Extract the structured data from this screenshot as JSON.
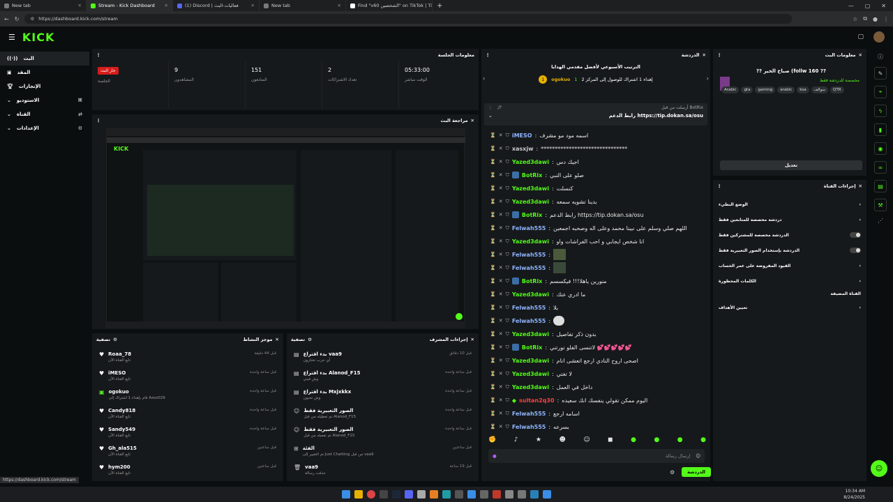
{
  "browser": {
    "tabs": [
      {
        "label": "New tab",
        "color": "#7a7a7a"
      },
      {
        "label": "Stream - Kick Dashboard",
        "color": "#53fc18"
      },
      {
        "label": "(1) Discord | فعاليات-البث",
        "color": "#5865f2"
      },
      {
        "label": "New tab",
        "color": "#7a7a7a"
      },
      {
        "label": "Find \"v60 الشخصين\" on TikTok | Ti",
        "color": "#ffffff"
      }
    ],
    "url": "https://dashboard.kick.com/stream",
    "status_url": "https://dashboard.kick.com/stream"
  },
  "brand": {
    "logo": "KICK",
    "accent": "#53fc18"
  },
  "sidebar": {
    "items": [
      {
        "label": "البث",
        "icon": "broadcast-icon"
      },
      {
        "label": "المقد",
        "icon": "content-icon"
      },
      {
        "label": "الإنجازات",
        "icon": "trophy-icon"
      },
      {
        "label": "الاستوديو",
        "icon": "studio-icon"
      },
      {
        "label": "القناة",
        "icon": "channel-icon"
      },
      {
        "label": "الإعدادات",
        "icon": "settings-icon"
      }
    ]
  },
  "session": {
    "title": "معلومات الجلسة",
    "stats": [
      {
        "value": "جار البث",
        "label": "الجلسة"
      },
      {
        "value": "9",
        "label": "المشاهدون"
      },
      {
        "value": "151",
        "label": "المتابعون"
      },
      {
        "value": "2",
        "label": "تعداد الاشتراكات"
      },
      {
        "value": "05:33:00",
        "label": "الوقت مباشر"
      }
    ]
  },
  "preview": {
    "title": "مراجعة البث"
  },
  "activity": {
    "title": "موجز النشاط",
    "filter": "تصفية",
    "items": [
      {
        "name": "Roaa_78",
        "sub": "تابع القناة الآن",
        "time": "قبل 44 دقيقة"
      },
      {
        "name": "iMESO",
        "sub": "تابع القناة الآن",
        "time": "قبل ساعة واحدة"
      },
      {
        "name": "ogokuo",
        "sub": "قام بإهداء 1 اشتراك إلى Azoz029",
        "time": "قبل ساعة واحدة"
      },
      {
        "name": "Candy818",
        "sub": "تابع القناة الآن",
        "time": "قبل ساعة واحدة"
      },
      {
        "name": "Sandy549",
        "sub": "تابع القناة الآن",
        "time": "قبل ساعة واحدة"
      },
      {
        "name": "Gh_ala515",
        "sub": "تابع القناة الآن",
        "time": "قبل ساعتين"
      },
      {
        "name": "hym200",
        "sub": "تابع القناة الآن",
        "time": "قبل ساعتين"
      }
    ]
  },
  "modactions": {
    "title": "إجراءات المشرف",
    "filter": "تصفية",
    "items": [
      {
        "title": "بدء اقتراع vaa9",
        "sub": "أي حزب تختارون",
        "time": "قبل 10 دقائق"
      },
      {
        "title": "بدء اقتراع Alanod_F15",
        "sub": "وش فيني",
        "time": "قبل ساعة واحدة"
      },
      {
        "title": "بدء اقتراع Mxjxkkx",
        "sub": "وش تحبون",
        "time": "قبل ساعة واحدة"
      },
      {
        "title": "الصور التعبيرية فقط",
        "sub": "تم تعطيله من قبل Alanod_F15",
        "time": "قبل ساعة واحدة"
      },
      {
        "title": "الصور التعبيرية فقط",
        "sub": "تم تفعيله من قبل Alanod_F15",
        "time": "قبل ساعة واحدة"
      },
      {
        "title": "الفئة",
        "sub": "تم التغيير إلى Just Chatting من قبل vaa9",
        "time": "قبل ساعتين"
      },
      {
        "title": "vaa9",
        "sub": "حذفت رسالة",
        "time": "قبل 19 ساعة"
      }
    ]
  },
  "chat": {
    "title": "الدردشة",
    "leaderboard_title": "الترتيب الأسبوعي لأفضل مقدمي الهدايا",
    "leader": {
      "rank": "1",
      "name": "ogokuo",
      "count": "1"
    },
    "leader_note": "إهداء 1 اشتراك للوصول إلى المركز 2",
    "pinned_by": "أرسلت من قبل BotRix",
    "pinned_text": "رابط الدعم https://tip.dokan.sa/osu",
    "messages": [
      {
        "user": "iMESO",
        "color": "#8fb4ff",
        "text": "اسمه مود مو مشرف"
      },
      {
        "user": "xasxjw",
        "color": "#c9c9c9",
        "text": "*******************************"
      },
      {
        "user": "Yazed3dawi",
        "color": "#53fc18",
        "text": "اجيك دس"
      },
      {
        "user": "BotRix",
        "color": "#53fc18",
        "text": "صلو على النبي"
      },
      {
        "user": "Yazed3dawi",
        "color": "#53fc18",
        "text": "كنسلت"
      },
      {
        "user": "Yazed3dawi",
        "color": "#53fc18",
        "text": "بدينا تشويه سمعه"
      },
      {
        "user": "BotRix",
        "color": "#53fc18",
        "text": "رابط الدعم https://tip.dokan.sa/osu"
      },
      {
        "user": "Felwah555",
        "color": "#8fb4ff",
        "text": "اللهم صلي وسلم على نبينا محمد وعلى اله وصحبه اجمعين"
      },
      {
        "user": "Yazed3dawi",
        "color": "#53fc18",
        "text": "انا شخص ايجابي و احب الفراشات واو"
      },
      {
        "user": "Felwah555",
        "color": "#8fb4ff",
        "text": ""
      },
      {
        "user": "Felwah555",
        "color": "#8fb4ff",
        "text": ""
      },
      {
        "user": "BotRix",
        "color": "#53fc18",
        "text": "منورين ياهلا!!! فيكسسم"
      },
      {
        "user": "Yazed3dawi",
        "color": "#53fc18",
        "text": "ما ادري عنك"
      },
      {
        "user": "Felwah555",
        "color": "#8fb4ff",
        "text": "بلا"
      },
      {
        "user": "Felwah555",
        "color": "#8fb4ff",
        "text": ""
      },
      {
        "user": "Yazed3dawi",
        "color": "#53fc18",
        "text": "بدون ذكر تفاصيل"
      },
      {
        "user": "BotRix",
        "color": "#53fc18",
        "text": "لاتنسى الفلو نورتني 💕💕💕💕💕"
      },
      {
        "user": "Yazed3dawi",
        "color": "#53fc18",
        "text": "اصحى اروح النادي ارجع اتعشى انام"
      },
      {
        "user": "Yazed3dawi",
        "color": "#53fc18",
        "text": "لا تغتي"
      },
      {
        "user": "Yazed3dawi",
        "color": "#53fc18",
        "text": "داخل في العمل"
      },
      {
        "user": "sultan2q30",
        "color": "#ff4040",
        "text": "اليوم ممكن تقولي ينفسك انك سعيده"
      },
      {
        "user": "Felwah555",
        "color": "#8fb4ff",
        "text": "اسامه ارجع"
      },
      {
        "user": "Felwah555",
        "color": "#8fb4ff",
        "text": "بسرعه"
      }
    ],
    "input_placeholder": "إرسال رسالة",
    "send_label": "الدردشة"
  },
  "streaminfo": {
    "title": "معلومات البث",
    "stream_title": "?? صباح الخير (follw 160 ??",
    "category": "مخصصة للدردشة فقط",
    "tags": [
      "Arabic",
      "gta",
      "gaming",
      "arabic",
      "ksa",
      "سوالف",
      "QTR"
    ],
    "edit_label": "تعديل"
  },
  "channelactions": {
    "title": "إجراءات القناة",
    "items": [
      {
        "label": "الوضع البطيء",
        "control": "chevron"
      },
      {
        "label": "دردشة مخصصة للمتابعين فقط",
        "control": "chevron"
      },
      {
        "label": "الدردشة مخصصة للمشتركين فقط",
        "control": "toggle"
      },
      {
        "label": "الدردشة بإستخدام الصور التعبيرية فقط",
        "control": "toggle"
      },
      {
        "label": "القيود المفروضة على عمر الحساب",
        "control": "chevron"
      },
      {
        "label": "الكلمات المحظورة",
        "control": "chevron"
      },
      {
        "label": "القناة المضيفة",
        "control": "none"
      },
      {
        "label": "تعيين الأهداف",
        "control": "chevron"
      }
    ]
  },
  "clock": {
    "time": "10:34 AM",
    "date": "8/24/2025"
  }
}
